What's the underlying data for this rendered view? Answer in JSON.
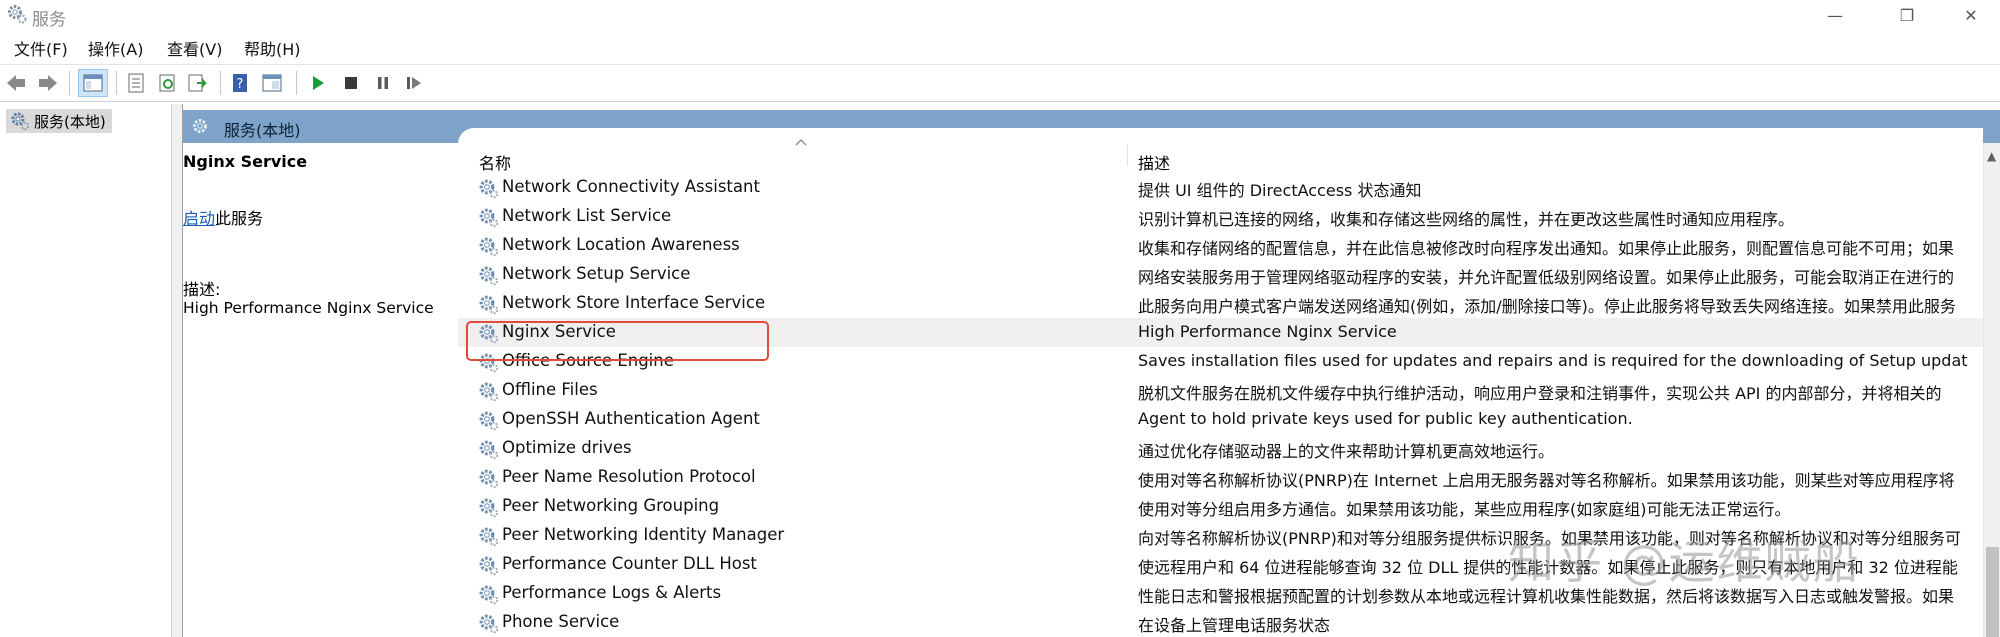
{
  "window": {
    "title": "服务",
    "controls": {
      "minimize": "—",
      "maximize": "❐",
      "close": "✕"
    }
  },
  "menu": [
    "文件(F)",
    "操作(A)",
    "查看(V)",
    "帮助(H)"
  ],
  "toolbar": {
    "icons": [
      "back-arrow-icon",
      "forward-arrow-icon",
      "show-hide-console-tree-icon",
      "properties-icon",
      "refresh-icon",
      "export-list-icon",
      "help-icon",
      "extended-view-icon",
      "start-service-icon",
      "stop-service-icon",
      "pause-service-icon",
      "restart-service-icon"
    ]
  },
  "tree": {
    "node_label": "服务(本地)"
  },
  "content": {
    "header_title": "服务(本地)"
  },
  "details": {
    "service_name": "Nginx Service",
    "action_link": "启动",
    "action_suffix": "此服务",
    "description_label": "描述:",
    "description": "High Performance Nginx Service"
  },
  "list": {
    "columns": {
      "name": "名称",
      "description": "描述"
    },
    "sort_indicator": "^",
    "selected_index": 5,
    "rows": [
      {
        "name": "Network Connectivity Assistant",
        "description": "提供 UI 组件的 DirectAccess 状态通知"
      },
      {
        "name": "Network List Service",
        "description": "识别计算机已连接的网络，收集和存储这些网络的属性，并在更改这些属性时通知应用程序。"
      },
      {
        "name": "Network Location Awareness",
        "description": "收集和存储网络的配置信息，并在此信息被修改时向程序发出通知。如果停止此服务，则配置信息可能不可用；如果"
      },
      {
        "name": "Network Setup Service",
        "description": "网络安装服务用于管理网络驱动程序的安装，并允许配置低级别网络设置。如果停止此服务，可能会取消正在进行的"
      },
      {
        "name": "Network Store Interface Service",
        "description": "此服务向用户模式客户端发送网络通知(例如，添加/删除接口等)。停止此服务将导致丢失网络连接。如果禁用此服务"
      },
      {
        "name": "Nginx Service",
        "description": "High Performance Nginx Service"
      },
      {
        "name": "Office  Source Engine",
        "description": "Saves installation files used for updates and repairs and is required for the downloading of Setup updat"
      },
      {
        "name": "Offline Files",
        "description": "脱机文件服务在脱机文件缓存中执行维护活动，响应用户登录和注销事件，实现公共 API 的内部部分，并将相关的"
      },
      {
        "name": "OpenSSH Authentication Agent",
        "description": "Agent to hold private keys used for public key authentication."
      },
      {
        "name": "Optimize drives",
        "description": "通过优化存储驱动器上的文件来帮助计算机更高效地运行。"
      },
      {
        "name": "Peer Name Resolution Protocol",
        "description": "使用对等名称解析协议(PNRP)在 Internet 上启用无服务器对等名称解析。如果禁用该功能，则某些对等应用程序将"
      },
      {
        "name": "Peer Networking Grouping",
        "description": "使用对等分组启用多方通信。如果禁用该功能，某些应用程序(如家庭组)可能无法正常运行。"
      },
      {
        "name": "Peer Networking Identity Manager",
        "description": "向对等名称解析协议(PNRP)和对等分组服务提供标识服务。如果禁用该功能，则对等名称解析协议和对等分组服务可"
      },
      {
        "name": "Performance Counter DLL Host",
        "description": "使远程用户和 64 位进程能够查询 32 位 DLL 提供的性能计数器。如果停止此服务，则只有本地用户和 32 位进程能"
      },
      {
        "name": "Performance Logs & Alerts",
        "description": "性能日志和警报根据预配置的计划参数从本地或远程计算机收集性能数据，然后将该数据写入日志或触发警报。如果"
      },
      {
        "name": "Phone Service",
        "description": "在设备上管理电话服务状态"
      }
    ]
  },
  "watermark": "知乎 @运维贼船",
  "colors": {
    "header_bar": "#7ea3c9",
    "highlight_box": "#e24a3b",
    "link": "#1a5db4",
    "selected_row": "#f0f0f0"
  }
}
